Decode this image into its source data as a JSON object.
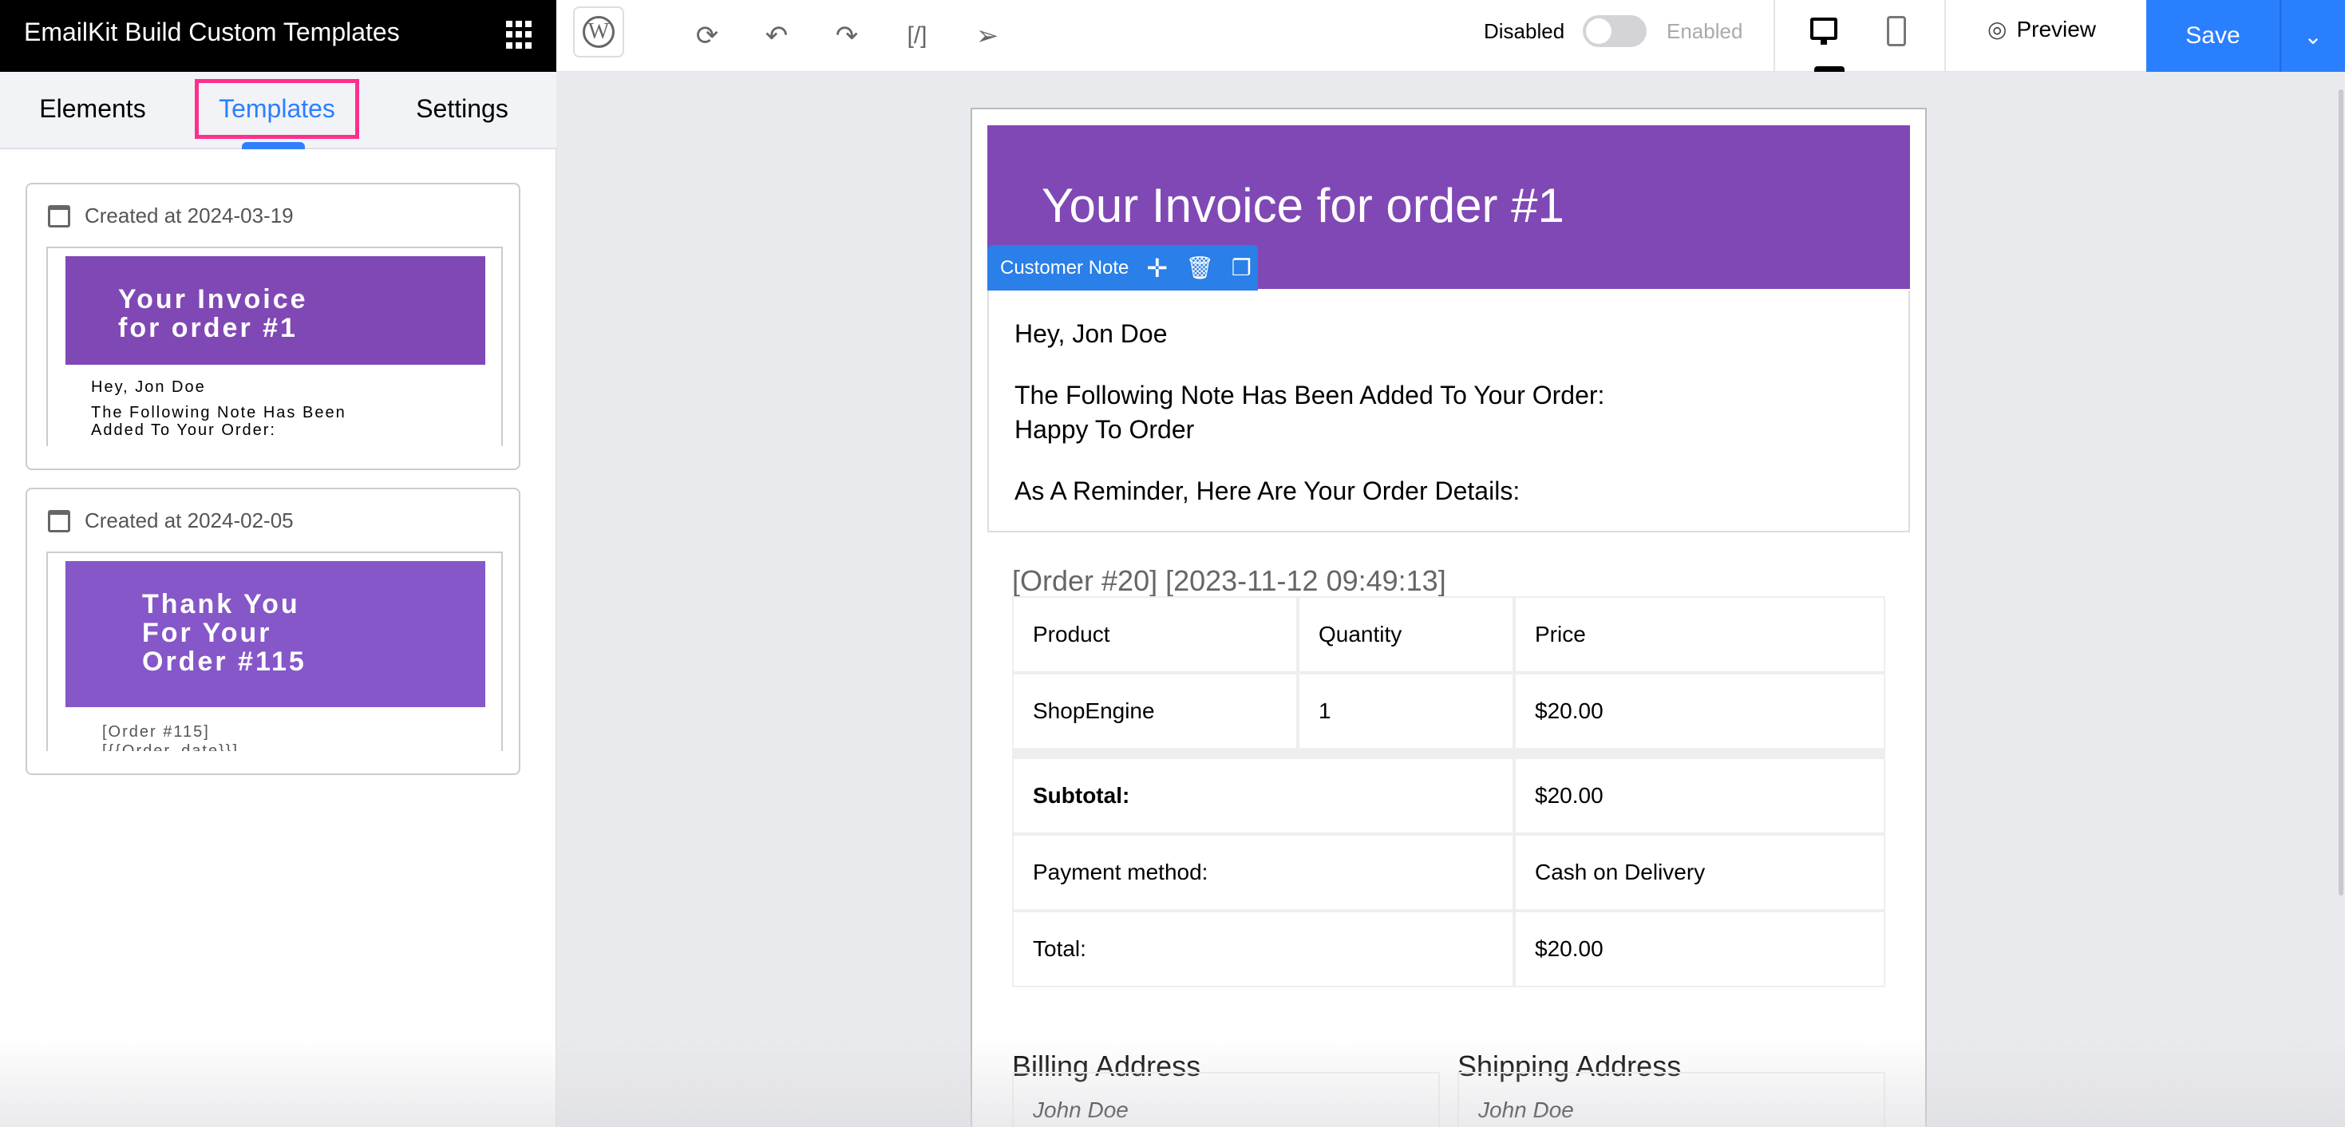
{
  "app": {
    "title": "EmailKit Build Custom Templates"
  },
  "sidebar": {
    "tabs": [
      {
        "label": "Elements"
      },
      {
        "label": "Templates",
        "active": true
      },
      {
        "label": "Settings"
      }
    ],
    "templates": [
      {
        "date": "Created at 2024-03-19",
        "preview_title": "Your Invoice for order #1",
        "preview_lines": [
          "Hey, Jon Doe",
          "The Following Note Has Been",
          "Added To Your Order:"
        ]
      },
      {
        "date": "Created at 2024-02-05",
        "preview_title_lines": [
          "Thank You",
          "For Your",
          "Order #115"
        ],
        "preview_lines": [
          "[Order #115]",
          "[{{Order_date}}]"
        ]
      }
    ]
  },
  "toolbar": {
    "disabled": "Disabled",
    "enabled": "Enabled",
    "toggle_on": false,
    "preview": "Preview",
    "save": "Save",
    "accent": "#2a7fff"
  },
  "email": {
    "title": "Your Invoice for order #1",
    "header_color": "#8048b5",
    "selected_block": "Customer Note",
    "note": {
      "greeting": "Hey, Jon Doe",
      "line1": "The Following Note Has Been Added To Your Order:",
      "line2": "Happy To Order",
      "line3": "As A Reminder, Here Are Your Order Details:"
    },
    "order_heading": "[Order #20] [2023-11-12 09:49:13]",
    "table": {
      "headers": [
        "Product",
        "Quantity",
        "Price"
      ],
      "rows": [
        [
          "ShopEngine",
          "1",
          "$20.00"
        ]
      ],
      "totals": [
        [
          "Subtotal:",
          "$20.00"
        ],
        [
          "Payment method:",
          "Cash on Delivery"
        ],
        [
          "Total:",
          "$20.00"
        ]
      ]
    },
    "billing": {
      "heading": "Billing Address",
      "name": "John Doe"
    },
    "shipping": {
      "heading": "Shipping Address",
      "name": "John Doe"
    }
  }
}
